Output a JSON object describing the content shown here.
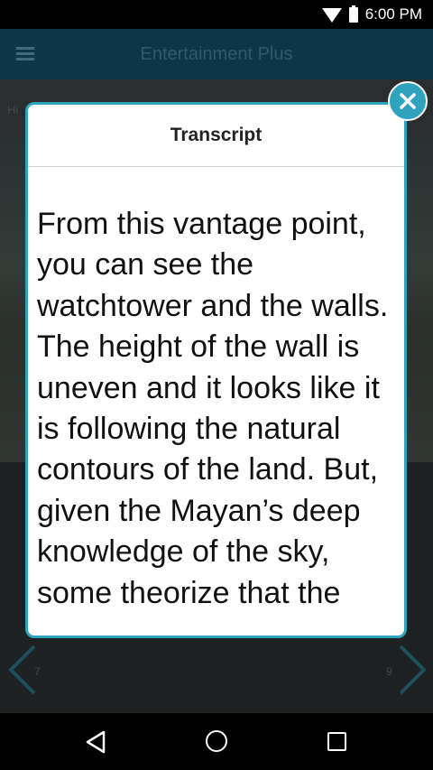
{
  "status_bar": {
    "time": "6:00 PM"
  },
  "app_bar": {
    "title": "Entertainment Plus"
  },
  "background": {
    "crumb": "Hi",
    "prev_page": "7",
    "next_page": "9"
  },
  "modal": {
    "title": "Transcript",
    "body": "From this vantage point, you can see the watchtower and the walls. The height of the wall is uneven and it looks like it is following the natural contours of the land. But, given the Mayan’s deep knowledge of the sky, some theorize that the"
  },
  "icons": {
    "close": "close-icon",
    "menu": "menu-icon",
    "back": "back-icon",
    "home": "home-icon",
    "recent": "recent-apps-icon"
  },
  "colors": {
    "accent": "#2fa3bd",
    "app_bar": "#0b3747"
  }
}
